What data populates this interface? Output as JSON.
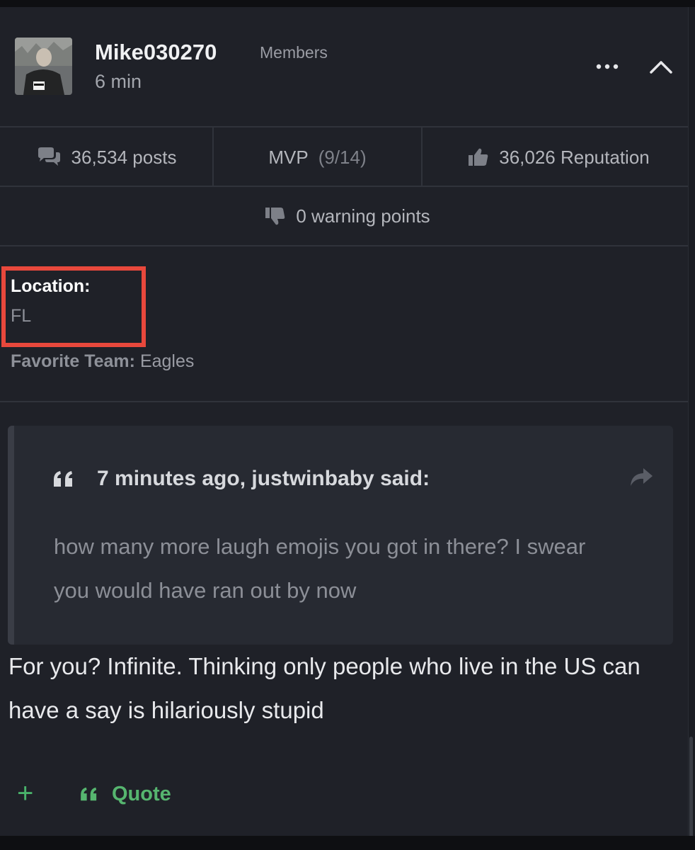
{
  "post": {
    "username": "Mike030270",
    "group": "Members",
    "time": "6 min"
  },
  "stats": {
    "posts": "36,534 posts",
    "mvp_label": "MVP",
    "mvp_count": "(9/14)",
    "reputation": "36,026 Reputation",
    "warning": "0 warning points"
  },
  "profile": {
    "location_label": "Location:",
    "location_value": "FL",
    "favorite_team_label": "Favorite Team:",
    "favorite_team_value": "Eagles"
  },
  "quote": {
    "citation": "7 minutes ago, justwinbaby said:",
    "text": "how many more laugh emojis you got in there? I swear you would have ran out by now"
  },
  "body": {
    "text": "For you? Infinite. Thinking only people who live in the US can have a say is hilariously stupid"
  },
  "actions": {
    "add": "+",
    "quote": "Quote"
  },
  "colors": {
    "background": "#1f2128",
    "accent_green": "#56b56f",
    "highlight_red": "#e8483c"
  },
  "icons": [
    "comments-icon",
    "thumbs-up-icon",
    "thumbs-down-icon",
    "quote-icon",
    "share-icon",
    "more-icon",
    "chevron-up-icon",
    "plus-icon"
  ]
}
